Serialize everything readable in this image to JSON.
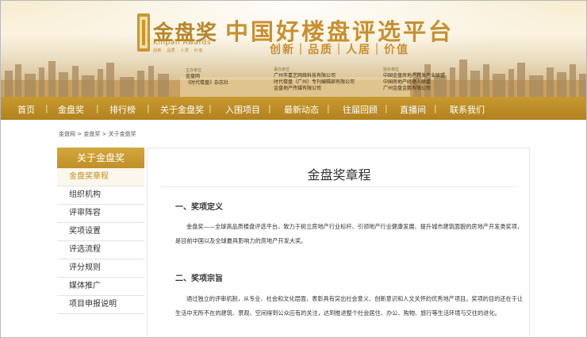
{
  "banner": {
    "logo_text": "金盘奖",
    "logo_en": "Kinpan Awards",
    "logo_tagline": "创新 · 品质 · 人居 · 价值",
    "main_title": "中国好楼盘评选平台",
    "slogan": "创新｜品质｜人居｜价值",
    "orgs": [
      {
        "caption": "主办单位",
        "lines": [
          "金盘网",
          "《时代楼盘》杂志社"
        ]
      },
      {
        "caption": "承办单位",
        "lines": [
          "广州市嘉艺网络科技有限公司",
          "时代楼盘（广州）专刊编辑部有限公司",
          "金盘地产传媒有限公司"
        ]
      },
      {
        "caption": "协办单位",
        "lines": [
          "中国金盘房地产开发产业联盟",
          "中国房地产经理人联盟",
          "广州金盘金鹏有限公司"
        ]
      }
    ]
  },
  "nav": {
    "items": [
      "首页",
      "金盘奖",
      "排行榜",
      "关于金盘奖",
      "入围项目",
      "最新动态",
      "往届回顾",
      "直播间",
      "联系我们"
    ]
  },
  "breadcrumb": "金盘网 > 金盘奖 > 关于金盘奖",
  "sidebar": {
    "header": "关于金盘奖",
    "items": [
      "金盘奖章程",
      "组织机构",
      "评审阵容",
      "奖项设置",
      "评选流程",
      "评分规则",
      "媒体推广",
      "项目申报说明"
    ],
    "active_index": 0
  },
  "content": {
    "title": "金盘奖章程",
    "sections": [
      {
        "heading": "一、奖项定义",
        "paragraph": "金盘奖——全球高品质楼盘评选平台，致力于树立房地产行业标杆、引领地产行业健康发展、提升城市建筑面貌的房地产开发类奖项，是目前中国以及全球最具影响力的房地产开发大奖。"
      },
      {
        "heading": "二、奖项宗旨",
        "paragraph": "通过独立的评审机制，从专业、社会和文化层面，表彰具有突出社会意义、创新意识和人文关怀的优秀地产项目。奖项的目的还在于让生活中无所不在的建筑、景观、空间得到公众应有的关注，达到推进整个社会居住、办公、购物、旅行等生活环境与交往的进化。"
      }
    ]
  },
  "colors": {
    "brand_gold": "#c4952c",
    "nav_bg": "#b98a25",
    "active_text": "#c28d1e"
  }
}
